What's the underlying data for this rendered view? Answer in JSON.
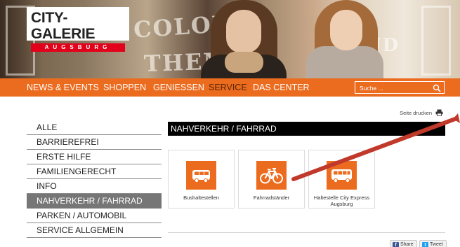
{
  "logo": {
    "title": "CITY-GALERIE",
    "subtitle": "AUGSBURG"
  },
  "hero": {
    "graffiti_1": "COLOUR",
    "graffiti_2": "THEM",
    "graffiti_3": "UD"
  },
  "nav": {
    "items": [
      {
        "label": "NEWS & EVENTS",
        "active": false
      },
      {
        "label": "SHOPPEN",
        "active": false
      },
      {
        "label": "GENIESSEN",
        "active": false
      },
      {
        "label": "SERVICE",
        "active": true
      },
      {
        "label": "DAS CENTER",
        "active": false
      }
    ],
    "search": {
      "placeholder": "Suche ...",
      "icon": "search-icon"
    }
  },
  "print": {
    "label": "Seite drucken",
    "icon": "printer-icon"
  },
  "sidebar": {
    "items": [
      {
        "label": "ALLE",
        "active": false
      },
      {
        "label": "BARRIEREFREI",
        "active": false
      },
      {
        "label": "ERSTE HILFE",
        "active": false
      },
      {
        "label": "FAMILIENGERECHT",
        "active": false
      },
      {
        "label": "INFO",
        "active": false
      },
      {
        "label": "NAHVERKEHR / FAHRRAD",
        "active": true
      },
      {
        "label": "PARKEN / AUTOMOBIL",
        "active": false
      },
      {
        "label": "SERVICE ALLGEMEIN",
        "active": false
      }
    ]
  },
  "main": {
    "heading": "NAHVERKEHR / FAHRRAD",
    "tiles": [
      {
        "label": "Bushaltestellen",
        "icon": "bus-icon"
      },
      {
        "label": "Fahrradständer",
        "icon": "bicycle-icon"
      },
      {
        "label": "Haltestelle City Express Augsburg",
        "icon": "bus-icon"
      }
    ]
  },
  "share": {
    "facebook_label": "Share",
    "twitter_label": "Tweet"
  },
  "colors": {
    "accent": "#ec6c1f",
    "active_nav_text": "#5a2400",
    "sidebar_active": "#767676",
    "heading_bg": "#000000",
    "annotation_arrow": "#c0392b"
  }
}
